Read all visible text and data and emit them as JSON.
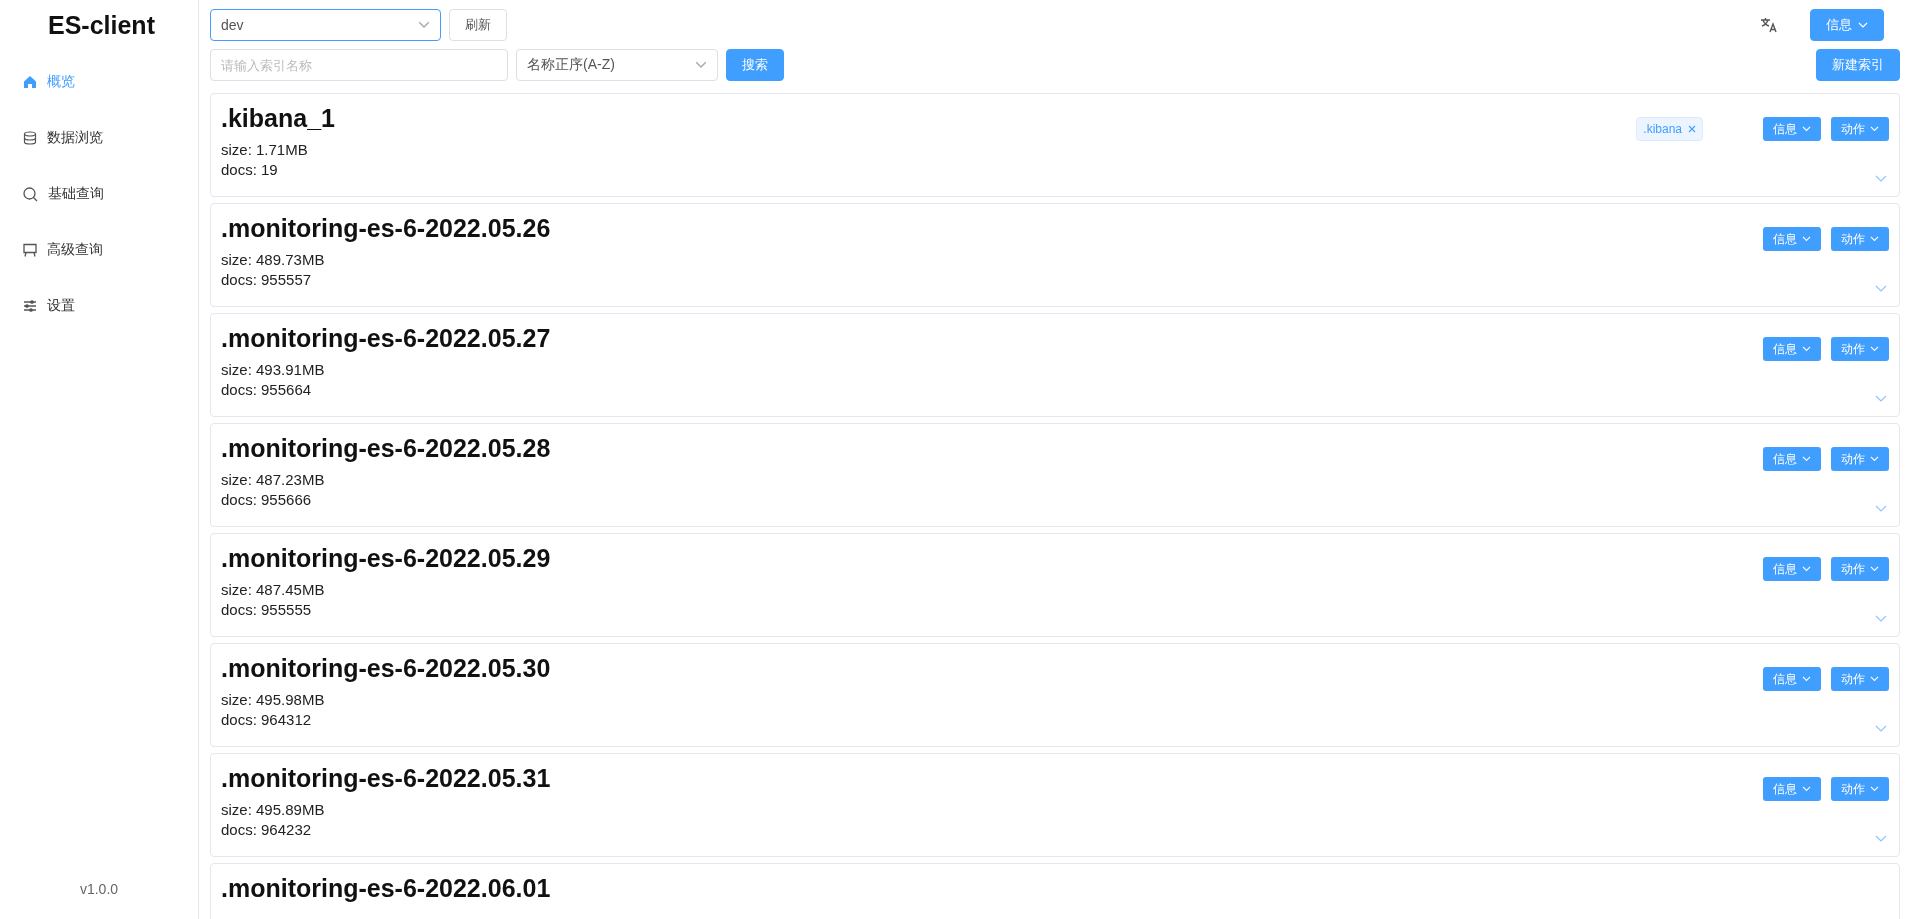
{
  "app": {
    "title": "ES-client",
    "version": "v1.0.0"
  },
  "sidebar": {
    "items": [
      {
        "label": "概览",
        "selected": true
      },
      {
        "label": "数据浏览",
        "selected": false
      },
      {
        "label": "基础查询",
        "selected": false
      },
      {
        "label": "高级查询",
        "selected": false
      },
      {
        "label": "设置",
        "selected": false
      }
    ]
  },
  "header": {
    "cluster_select": {
      "value": "dev"
    },
    "refresh_button": "刷新",
    "info_button": "信息"
  },
  "toolbar": {
    "search_field": {
      "placeholder": "请输入索引名称"
    },
    "sort_select": {
      "value": "名称正序(A-Z)"
    },
    "search_button": "搜索",
    "new_index_button": "新建索引"
  },
  "indices": [
    {
      "name": ".kibana_1",
      "size": "size: 1.71MB",
      "docs": "docs: 19",
      "tags": [
        ".kibana"
      ],
      "actions": [
        "信息",
        "动作"
      ]
    },
    {
      "name": ".monitoring-es-6-2022.05.26",
      "size": "size: 489.73MB",
      "docs": "docs: 955557",
      "actions": [
        "信息",
        "动作"
      ]
    },
    {
      "name": ".monitoring-es-6-2022.05.27",
      "size": "size: 493.91MB",
      "docs": "docs: 955664",
      "actions": [
        "信息",
        "动作"
      ]
    },
    {
      "name": ".monitoring-es-6-2022.05.28",
      "size": "size: 487.23MB",
      "docs": "docs: 955666",
      "actions": [
        "信息",
        "动作"
      ]
    },
    {
      "name": ".monitoring-es-6-2022.05.29",
      "size": "size: 487.45MB",
      "docs": "docs: 955555",
      "actions": [
        "信息",
        "动作"
      ]
    },
    {
      "name": ".monitoring-es-6-2022.05.30",
      "size": "size: 495.98MB",
      "docs": "docs: 964312",
      "actions": [
        "信息",
        "动作"
      ]
    },
    {
      "name": ".monitoring-es-6-2022.05.31",
      "size": "size: 495.89MB",
      "docs": "docs: 964232",
      "actions": [
        "信息",
        "动作"
      ]
    },
    {
      "name": ".monitoring-es-6-2022.06.01"
    }
  ]
}
